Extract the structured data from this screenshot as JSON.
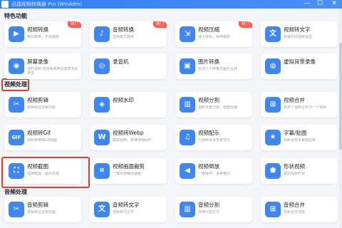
{
  "window": {
    "title": "迅捷视频转换器 Pro (WinAdm)",
    "minimize": "—",
    "maximize": "☐",
    "close": "✕"
  },
  "sections": {
    "special": "特色功能",
    "video": "视频处理",
    "audio": "音频处理"
  },
  "badge": "热门",
  "cards": [
    {
      "name": "视频转换",
      "desc": "格式转换，无损画质",
      "icon": "▶",
      "badge": true
    },
    {
      "name": "音频转换",
      "desc": "音频格式转换",
      "icon": "♪",
      "badge": true
    },
    {
      "name": "视频压缩",
      "desc": "减小体积，保持画质",
      "icon": "⇲",
      "badge": true
    },
    {
      "name": "视频转文字",
      "desc": "快速识别视频语音",
      "icon": "文",
      "badge": false
    },
    {
      "name": "屏幕录像",
      "desc": "实时录制 支持系统声音和麦克风录音",
      "icon": "◉",
      "badge": false
    },
    {
      "name": "录音机",
      "desc": "",
      "icon": "◎",
      "badge": false
    },
    {
      "name": "图片转换",
      "desc": "支持几十种格式图片互转",
      "icon": "▣",
      "badge": false
    },
    {
      "name": "虚拟背景录像",
      "desc": "",
      "icon": "◍",
      "badge": false
    },
    {
      "name": "视频剪辑",
      "desc": "视频综合剪辑功能",
      "icon": "✂",
      "badge": false
    },
    {
      "name": "视频水印",
      "desc": "",
      "icon": "◈",
      "badge": false
    },
    {
      "name": "视频分割",
      "desc": "视频长度分割，画面剪裁",
      "icon": "▥",
      "badge": false
    },
    {
      "name": "视频合并",
      "desc": "将多个视频合并为一个视频",
      "icon": "⊞",
      "badge": false
    },
    {
      "name": "视频转Gif",
      "desc": "视频转换成Gif动图",
      "icon": "GIF",
      "badge": false
    },
    {
      "name": "视频转Webp",
      "desc": "截取视频，转换成WebP",
      "icon": "W",
      "badge": false
    },
    {
      "name": "视频配乐",
      "desc": "为视频添加背景音乐",
      "icon": "♫",
      "badge": false
    },
    {
      "name": "字幕/贴图",
      "desc": "视频添加字幕或贴纸",
      "icon": "★",
      "badge": false
    },
    {
      "name": "视频截图",
      "desc": "连续截图，输出长图",
      "icon": "⛶",
      "badge": false
    },
    {
      "name": "视频画面裁剪",
      "desc": "一键快速裁剪画面",
      "icon": "⌗",
      "badge": false
    },
    {
      "name": "视频倒放",
      "desc": "一键操作，多种格式",
      "icon": "◀",
      "badge": false
    },
    {
      "name": "形状视频",
      "desc": "做出视频形状",
      "icon": "⬟",
      "badge": false
    },
    {
      "name": "音频剪辑",
      "desc": "音频综合剪辑功能",
      "icon": "✂",
      "badge": false
    },
    {
      "name": "音频转文字",
      "desc": "音频转为文字",
      "icon": "文",
      "badge": false
    },
    {
      "name": "音频分割",
      "desc": "多种分割方式",
      "icon": "▥",
      "badge": false
    },
    {
      "name": "音频合并",
      "desc": "音频合并功能",
      "icon": "⊞",
      "badge": false
    }
  ]
}
